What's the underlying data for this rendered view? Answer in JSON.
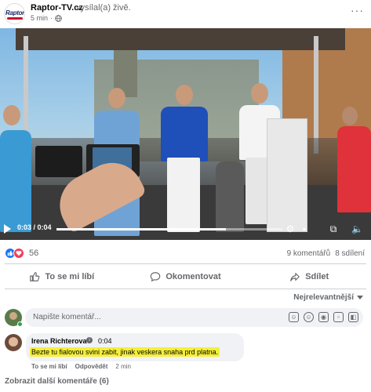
{
  "post": {
    "page_name": "Raptor-TV.cz",
    "action_text": "vysílal(a) živě.",
    "time_ago": "5 min",
    "logo_text": "RaptorTV"
  },
  "video": {
    "time": "0:03 / 0:04",
    "progress": 0.75
  },
  "engagement": {
    "reaction_count": "56",
    "comments": "9 komentářů",
    "shares": "8 sdílení"
  },
  "actions": {
    "like": "To se mi líbí",
    "comment": "Okomentovat",
    "share": "Sdílet"
  },
  "sort": {
    "label": "Nejrelevantnější"
  },
  "composer": {
    "placeholder": "Napište komentář..."
  },
  "comment": {
    "author": "Irena Richterova",
    "inline_time": "0:04",
    "text": "Bezte tu fialovou svini zabit, jinak veskera snaha prd platna.",
    "like": "To se mi líbí",
    "reply": "Odpovědět",
    "time_ago": "2 min"
  },
  "more_comments": "Zobrazit další komentáře (6)",
  "colors": {
    "facebook_blue": "#1877f2",
    "love_red": "#f33e58",
    "highlight_yellow": "#f5ef3a",
    "muted_text": "#65676b"
  }
}
